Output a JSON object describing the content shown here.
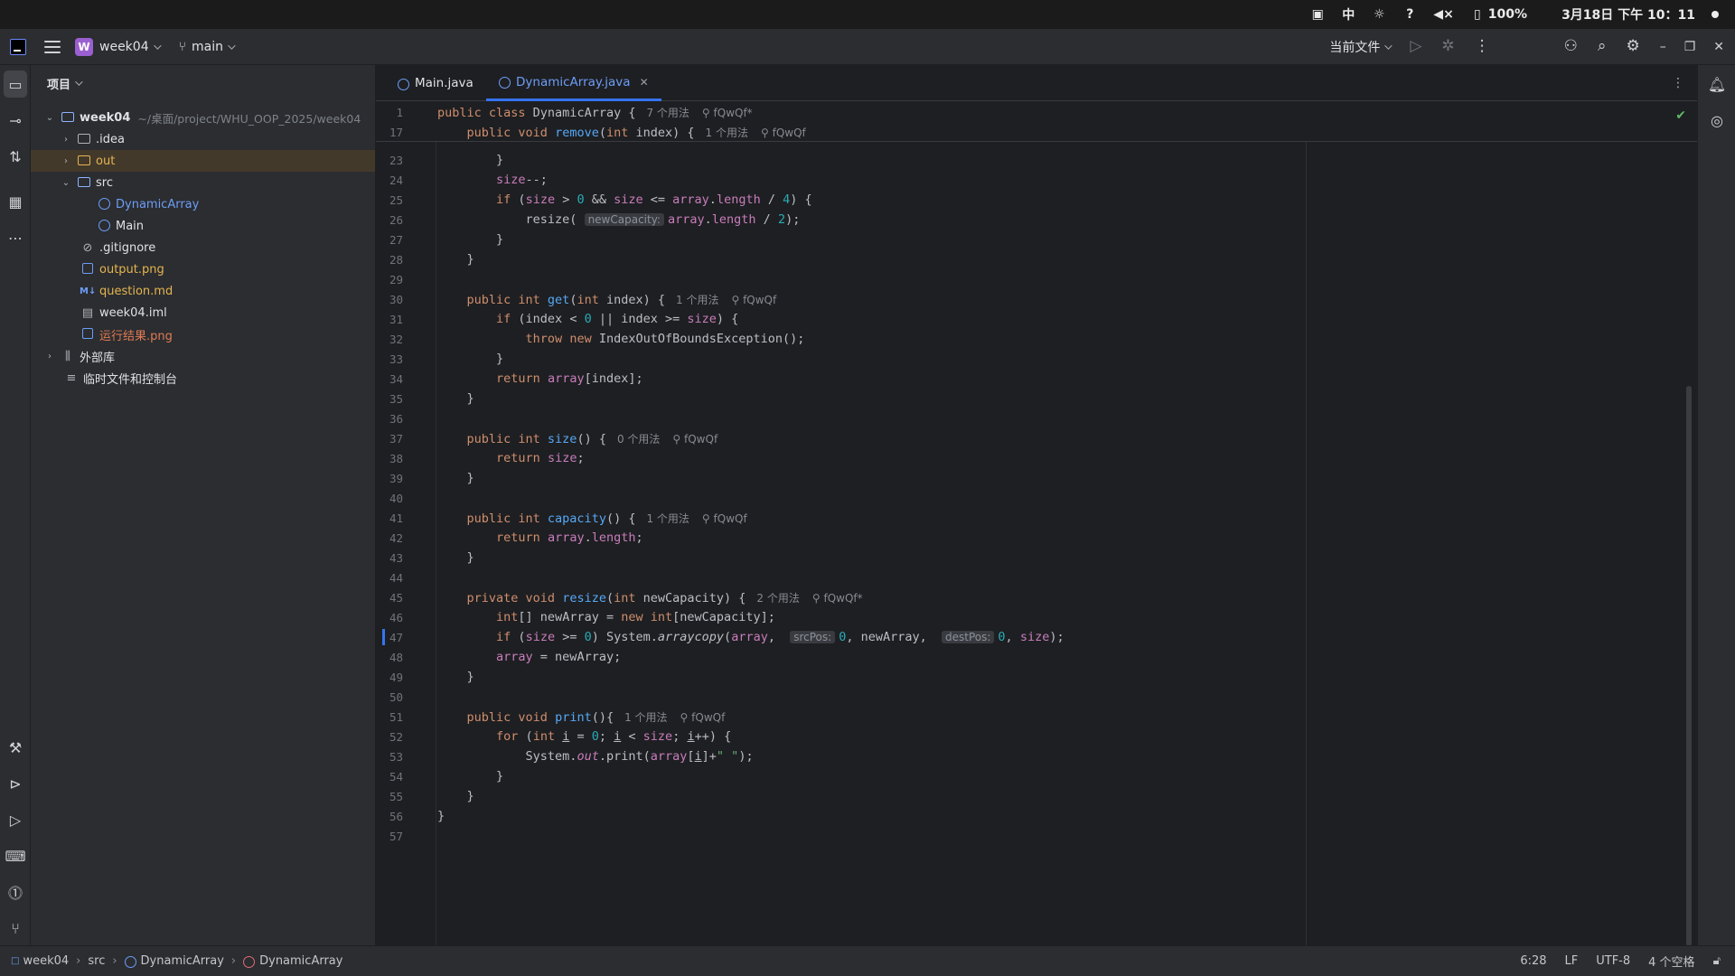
{
  "os_bar": {
    "input_method": "中",
    "battery": "100%",
    "datetime": "3月18日 下午 10：11"
  },
  "toolbar": {
    "project_badge": "W",
    "project_name": "week04",
    "branch": "main",
    "run_config": "当前文件"
  },
  "project_panel": {
    "header": "项目",
    "tree": [
      {
        "label": "week04",
        "path": "~/桌面/project/WHU_OOP_2025/week04"
      },
      {
        "label": ".idea"
      },
      {
        "label": "out"
      },
      {
        "label": "src"
      },
      {
        "label": "DynamicArray"
      },
      {
        "label": "Main"
      },
      {
        "label": ".gitignore"
      },
      {
        "label": "output.png"
      },
      {
        "label": "question.md"
      },
      {
        "label": "week04.iml"
      },
      {
        "label": "运行结果.png"
      },
      {
        "label": "外部库"
      },
      {
        "label": "临时文件和控制台"
      }
    ]
  },
  "tabs": [
    {
      "label": "Main.java"
    },
    {
      "label": "DynamicArray.java"
    }
  ],
  "sticky": [
    {
      "ln": "1",
      "usage": "7 个用法",
      "author": "fQwQf*"
    },
    {
      "ln": "17",
      "usage": "1 个用法",
      "author": "fQwQf"
    }
  ],
  "lines": {
    "l23": "23",
    "l24": "24",
    "l25": "25",
    "l26": "26",
    "l27": "27",
    "l28": "28",
    "l29": "29",
    "l30": "30",
    "l31": "31",
    "l32": "32",
    "l33": "33",
    "l34": "34",
    "l35": "35",
    "l36": "36",
    "l37": "37",
    "l38": "38",
    "l39": "39",
    "l40": "40",
    "l41": "41",
    "l42": "42",
    "l43": "43",
    "l44": "44",
    "l45": "45",
    "l46": "46",
    "l47": "47",
    "l48": "48",
    "l49": "49",
    "l50": "50",
    "l51": "51",
    "l52": "52",
    "l53": "53",
    "l54": "54",
    "l55": "55",
    "l56": "56",
    "l57": "57"
  },
  "hints": {
    "newCapacity": "newCapacity:",
    "srcPos": "srcPos:",
    "destPos": "destPos:"
  },
  "usages": {
    "get": "1 个用法",
    "get_author": "fQwQf",
    "size": "0 个用法",
    "size_author": "fQwQf",
    "capacity": "1 个用法",
    "capacity_author": "fQwQf",
    "resize": "2 个用法",
    "resize_author": "fQwQf*",
    "print": "1 个用法",
    "print_author": "fQwQf"
  },
  "status_bar": {
    "breadcrumbs": [
      "week04",
      "src",
      "DynamicArray",
      "DynamicArray"
    ],
    "position": "6:28",
    "line_sep": "LF",
    "encoding": "UTF-8",
    "indent": "4 个空格"
  },
  "colors": {
    "accent": "#3574f0",
    "keyword": "#cf8e6d",
    "function": "#56a8f5",
    "field": "#c77dbb",
    "number": "#2aacb8"
  }
}
